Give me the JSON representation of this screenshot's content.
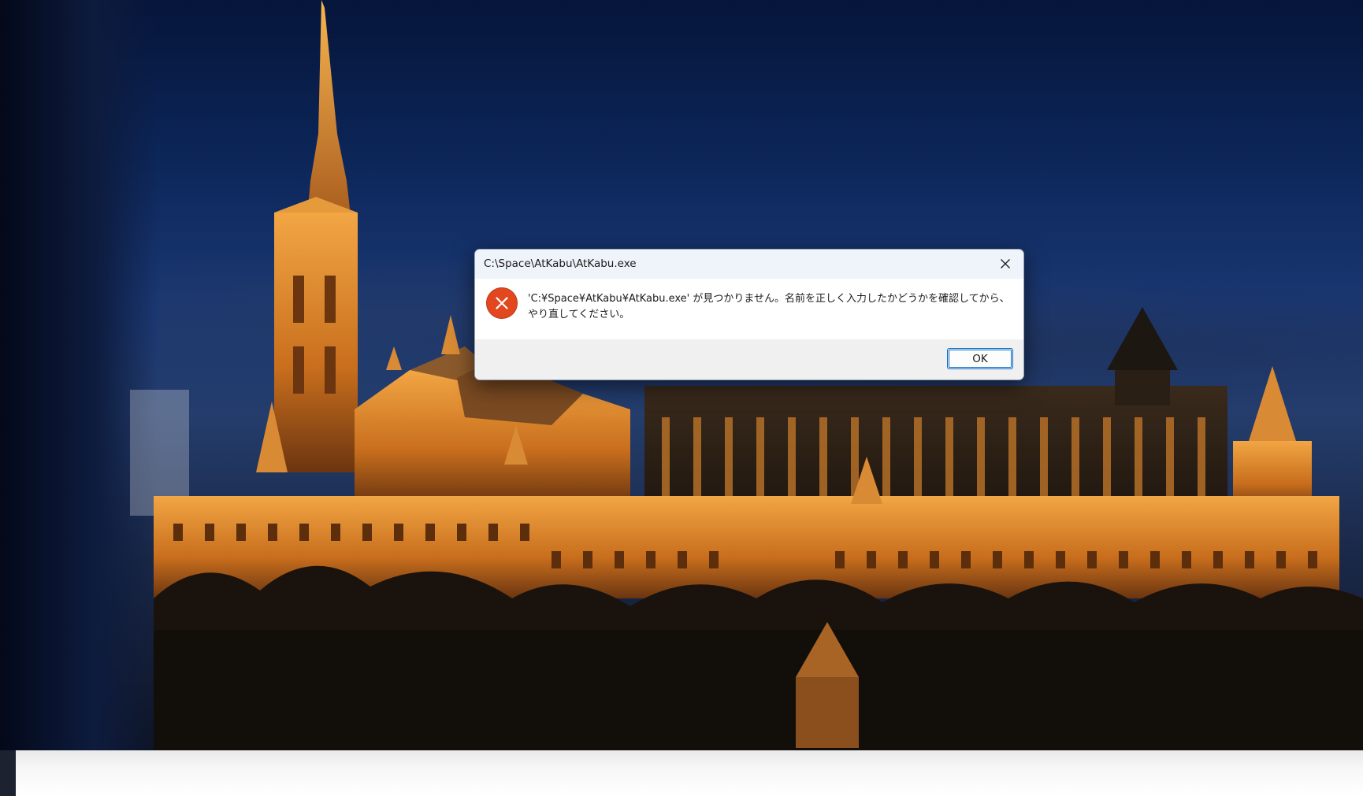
{
  "desktop": {
    "wallpaper": "night-castle-wallpaper"
  },
  "dialog": {
    "title": "C:\\Space\\AtKabu\\AtKabu.exe",
    "message": "'C:¥Space¥AtKabu¥AtKabu.exe' が見つかりません。名前を正しく入力したかどうかを確認してから、やり直してください。",
    "ok_label": "OK",
    "icon": "error-icon",
    "close_icon": "close-icon",
    "colors": {
      "error_icon": "#e2471f",
      "titlebar": "#eff3fa",
      "footer": "#f0f0f0",
      "accent": "#0067c0"
    }
  }
}
